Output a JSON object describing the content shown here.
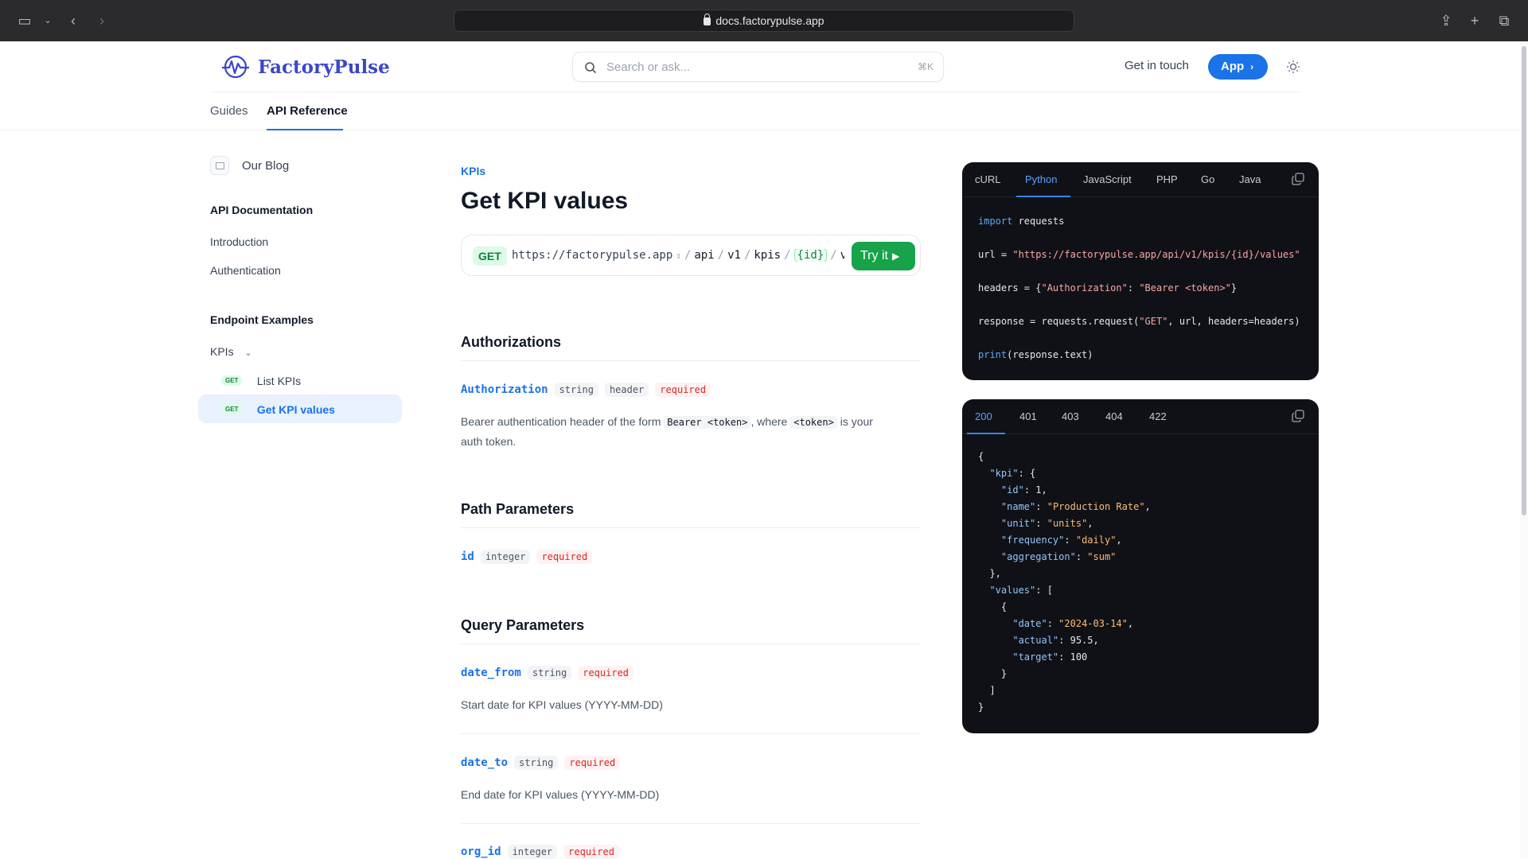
{
  "browser": {
    "url": "docs.factorypulse.app"
  },
  "header": {
    "logo_text": "FactoryPulse",
    "search_placeholder": "Search or ask...",
    "search_shortcut": "⌘K",
    "get_in_touch": "Get in touch",
    "app_button": "App",
    "tabs": [
      "Guides",
      "API Reference"
    ]
  },
  "sidebar": {
    "blog": "Our Blog",
    "section1": "API Documentation",
    "items1": [
      "Introduction",
      "Authentication"
    ],
    "section2": "Endpoint Examples",
    "group": "KPIs",
    "method": "GET",
    "endpoints": [
      "List KPIs",
      "Get KPI values"
    ]
  },
  "main": {
    "breadcrumb": "KPIs",
    "title": "Get KPI values",
    "endpoint": {
      "method": "GET",
      "base": "https://factorypulse.app",
      "seg1": "api",
      "seg2": "v1",
      "seg3": "kpis",
      "param": "{id}",
      "seg4": "va",
      "try": "Try it"
    },
    "auth": {
      "heading": "Authorizations",
      "name": "Authorization",
      "type": "string",
      "loc": "header",
      "req": "required",
      "d1": "Bearer authentication header of the form",
      "c1": "Bearer <token>",
      "d2": ", where",
      "c2": "<token>",
      "d3": "is your",
      "d4": "auth token."
    },
    "path": {
      "heading": "Path Parameters",
      "name": "id",
      "type": "integer",
      "req": "required"
    },
    "query": {
      "heading": "Query Parameters",
      "p1": {
        "name": "date_from",
        "type": "string",
        "req": "required",
        "desc": "Start date for KPI values (YYYY-MM-DD)"
      },
      "p2": {
        "name": "date_to",
        "type": "string",
        "req": "required",
        "desc": "End date for KPI values (YYYY-MM-DD)"
      },
      "p3": {
        "name": "org_id",
        "type": "integer",
        "req": "required"
      }
    }
  },
  "request_panel": {
    "tabs": [
      "cURL",
      "Python",
      "JavaScript",
      "PHP",
      "Go",
      "Java"
    ],
    "active": "Python",
    "lines": {
      "l1a": "import",
      "l1b": " requests",
      "l2a": "url",
      "l2b": " = ",
      "l2c": "\"https://factorypulse.app/api/v1/kpis/{id}/values\"",
      "l3a": "headers",
      "l3b": " = {",
      "l3c": "\"Authorization\"",
      "l3d": ": ",
      "l3e": "\"Bearer <token>\"",
      "l3f": "}",
      "l4a": "response",
      "l4b": " = requests.request(",
      "l4c": "\"GET\"",
      "l4d": ", url, headers=headers)",
      "l5a": "print",
      "l5b": "(response.text)"
    }
  },
  "response_panel": {
    "tabs": [
      "200",
      "401",
      "403",
      "404",
      "422"
    ],
    "active": "200",
    "json": {
      "kpi_key": "\"kpi\"",
      "id_key": "\"id\"",
      "id_val": "1",
      "name_key": "\"name\"",
      "name_val": "\"Production Rate\"",
      "unit_key": "\"unit\"",
      "unit_val": "\"units\"",
      "freq_key": "\"frequency\"",
      "freq_val": "\"daily\"",
      "agg_key": "\"aggregation\"",
      "agg_val": "\"sum\"",
      "values_key": "\"values\"",
      "date_key": "\"date\"",
      "date_val": "\"2024-03-14\"",
      "actual_key": "\"actual\"",
      "actual_val": "95.5",
      "target_key": "\"target\"",
      "target_val": "100"
    }
  }
}
